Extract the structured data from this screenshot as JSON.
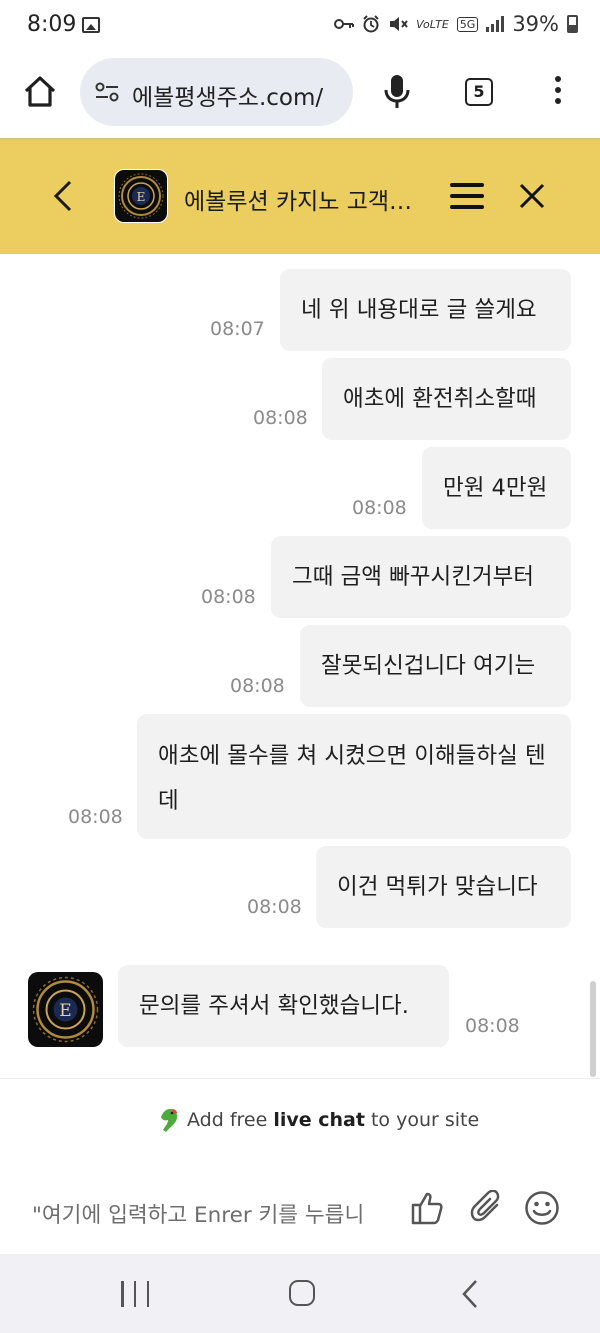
{
  "status_bar": {
    "time": "8:09",
    "network": "5G",
    "volte": "VoLTE",
    "battery": "39%"
  },
  "browser": {
    "url": "에볼평생주소.com/",
    "tab_count": "5"
  },
  "header": {
    "title": "에볼루션 카지노 고객…",
    "logo_letter": "E"
  },
  "messages": [
    {
      "text": "네 위 내용대로 글 쓸게요",
      "time": "08:07",
      "side": "right"
    },
    {
      "text": "애초에 환전취소할때",
      "time": "08:08",
      "side": "right"
    },
    {
      "text": "만원 4만원",
      "time": "08:08",
      "side": "right"
    },
    {
      "text": "그때 금액 빠꾸시킨거부터",
      "time": "08:08",
      "side": "right"
    },
    {
      "text": "잘못되신겁니다 여기는",
      "time": "08:08",
      "side": "right"
    },
    {
      "text": "애초에 몰수를 쳐 시켰으면 이해들하실 텐데",
      "time": "08:08",
      "side": "right"
    },
    {
      "text": "이건 먹튀가 맞습니다",
      "time": "08:08",
      "side": "right"
    },
    {
      "text": "문의를 주셔서 확인했습니다.",
      "time": "08:08",
      "side": "left"
    }
  ],
  "powered": {
    "prefix": "Add free ",
    "bold": "live chat",
    "suffix": " to your site"
  },
  "composer": {
    "placeholder": "\"여기에 입력하고 Enrer 키를 누릅니"
  },
  "colors": {
    "header_bg": "#ebce5f",
    "bubble_bg": "#f2f2f2",
    "accent": "#1f1f1f"
  }
}
